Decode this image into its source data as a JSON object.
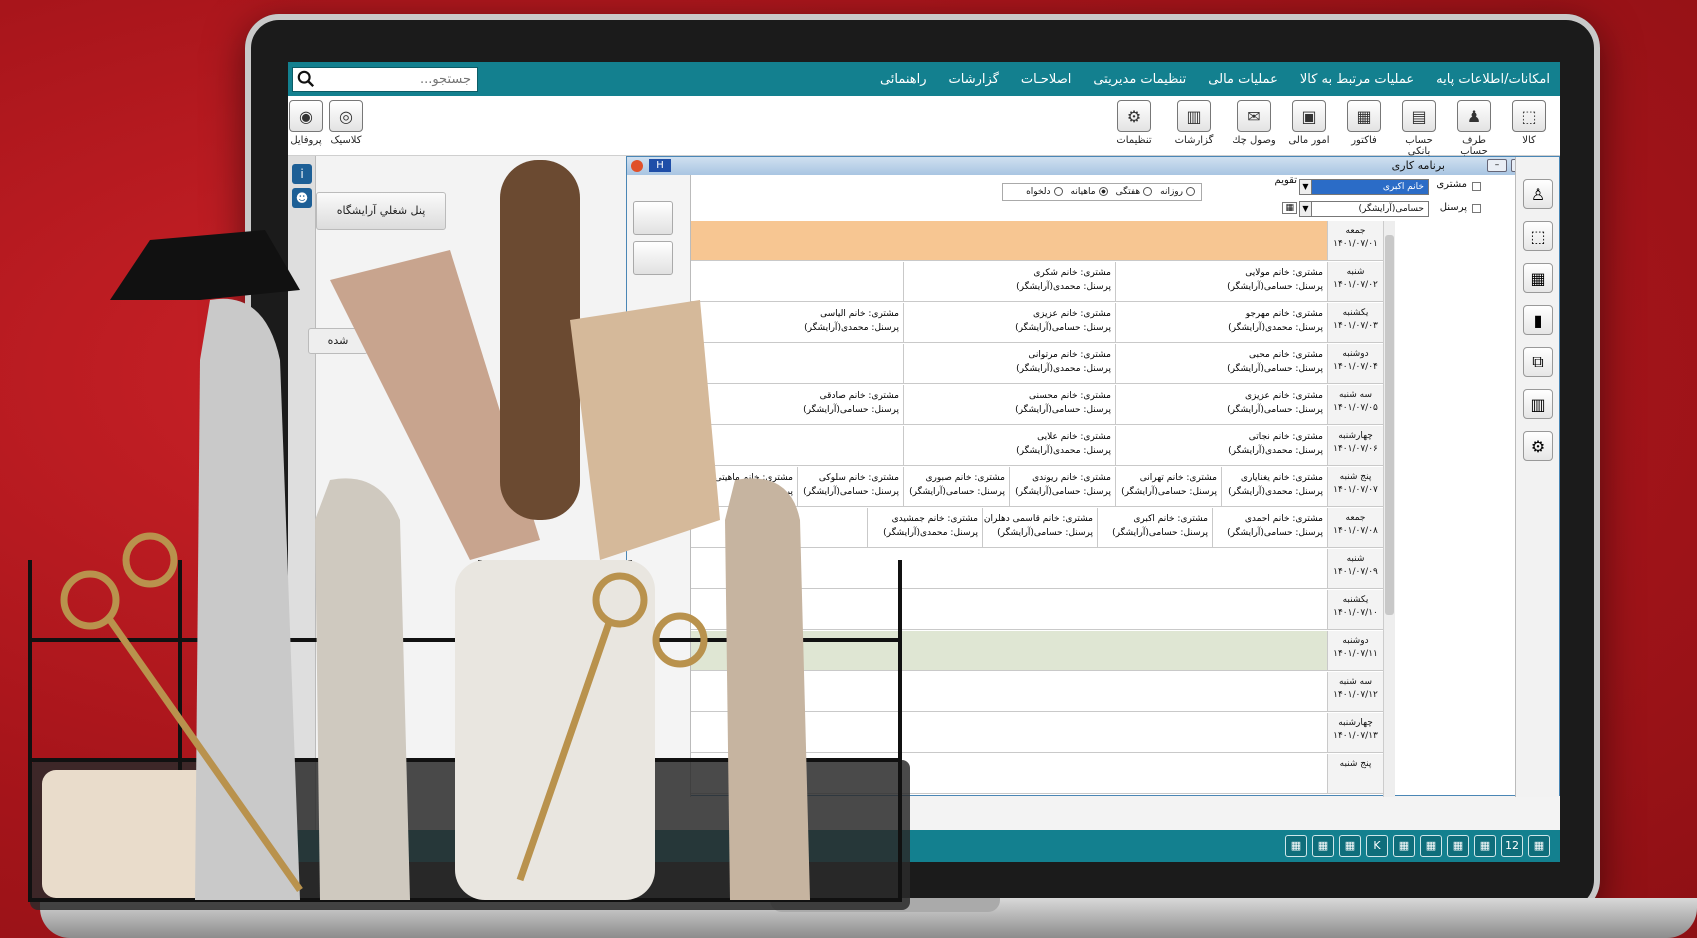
{
  "menubar": {
    "items": [
      "امکانات/اطلاعات پایه",
      "عملیات مرتبط به کالا",
      "عملیات مالی",
      "تنظیمات مدیریتی",
      "اصلاحـات",
      "گزارشات",
      "راهنمائی"
    ]
  },
  "search": {
    "placeholder": "جستجو..."
  },
  "toolbar": {
    "items": [
      "کالا",
      "طرف حساب",
      "حساب بانکی",
      "فاکتور",
      "امور مالی",
      "وصول چك",
      "گزارشات",
      "تنظیمات"
    ],
    "left_items": [
      "کلاسیک",
      "پروفایل"
    ]
  },
  "left_panel": {
    "button": "پنل شغلي آرایشگاه",
    "partial": "شده"
  },
  "window": {
    "title": "برنامه کاری",
    "badge": "H",
    "customer_label": "مشتری",
    "customer_value": "خانم اکبری",
    "staff_label": "پرسنل",
    "staff_value": "حسامی(آرایشگر)",
    "calendar_label": "تقویم",
    "radio_daily": "روزانه",
    "radio_weekly": "هفتگی",
    "radio_monthly": "ماهیانه",
    "radio_custom": "دلخواه"
  },
  "schedule": {
    "rows": [
      {
        "day": "جمعه",
        "date": "۱۴۰۱/۰۷/۰۱",
        "color": "#f7c692",
        "appts": []
      },
      {
        "day": "شنبه",
        "date": "۱۴۰۱/۰۷/۰۲",
        "color": "",
        "appts": [
          [
            "مشتری: خانم مولایی",
            "پرسنل: حسامی(آرایشگر)"
          ],
          [
            "مشتری: خانم شکری",
            "پرسنل: محمدی(آرایشگر)"
          ]
        ]
      },
      {
        "day": "یکشنبه",
        "date": "۱۴۰۱/۰۷/۰۳",
        "color": "",
        "appts": [
          [
            "مشتری: خانم مهرجو",
            "پرسنل: محمدی(آرایشگر)"
          ],
          [
            "مشتری: خانم عزیزی",
            "پرسنل: حسامی(آرایشگر)"
          ],
          [
            "مشتری: خانم الیاسی",
            "پرسنل: محمدی(آرایشگر)"
          ]
        ]
      },
      {
        "day": "دوشنبه",
        "date": "۱۴۰۱/۰۷/۰۴",
        "color": "",
        "appts": [
          [
            "مشتری: خانم محبی",
            "پرسنل: حسامی(آرایشگر)"
          ],
          [
            "مشتری: خانم مرتوانی",
            "پرسنل: محمدی(آرایشگر)"
          ]
        ]
      },
      {
        "day": "سه شنبه",
        "date": "۱۴۰۱/۰۷/۰۵",
        "color": "",
        "appts": [
          [
            "مشتری: خانم عزیزی",
            "پرسنل: حسامی(آرایشگر)"
          ],
          [
            "مشتری: خانم محسنی",
            "پرسنل: حسامی(آرایشگر)"
          ],
          [
            "مشتری: خانم صادقی",
            "پرسنل: حسامی(آرایشگر)"
          ]
        ]
      },
      {
        "day": "چهارشنبه",
        "date": "۱۴۰۱/۰۷/۰۶",
        "color": "",
        "appts": [
          [
            "مشتری: خانم نجاتی",
            "پرسنل: محمدی(آرایشگر)"
          ],
          [
            "مشتری: خانم علایی",
            "پرسنل: محمدی(آرایشگر)"
          ]
        ]
      },
      {
        "day": "پنج شنبه",
        "date": "۱۴۰۱/۰۷/۰۷",
        "color": "",
        "appts": [
          [
            "مشتری: خانم یغنایاری",
            "پرسنل: محمدی(آرایشگر)"
          ],
          [
            "مشتری: خانم تهرانی",
            "پرسنل: حسامی(آرایشگر)"
          ],
          [
            "مشتری: خانم ریوندی",
            "پرسنل: حسامی(آرایشگر)"
          ],
          [
            "مشتری: خانم صبوری",
            "پرسنل: حسامی(آرایشگر)"
          ],
          [
            "مشتری: خانم سلوکی",
            "پرسنل: حسامی(آرایشگر)"
          ],
          [
            "مشتری: خانم ماهیتی",
            "پرسنل: حسا"
          ]
        ]
      },
      {
        "day": "جمعه",
        "date": "۱۴۰۱/۰۷/۰۸",
        "color": "",
        "appts": [
          [
            "مشتری: خانم احمدی",
            "پرسنل: حسامی(آرایشگر)"
          ],
          [
            "مشتری: خانم اکبری",
            "پرسنل: حسامی(آرایشگر)"
          ],
          [
            "مشتری: خانم قاسمی دهلران",
            "پرسنل: حسامی(آرایشگر)"
          ],
          [
            "مشتری: خانم جمشیدی",
            "پرسنل: محمدی(آرایشگر)"
          ]
        ]
      },
      {
        "day": "شنبه",
        "date": "۱۴۰۱/۰۷/۰۹",
        "color": "",
        "appts": []
      },
      {
        "day": "یکشنبه",
        "date": "۱۴۰۱/۰۷/۱۰",
        "color": "",
        "appts": []
      },
      {
        "day": "دوشنبه",
        "date": "۱۴۰۱/۰۷/۱۱",
        "color": "#dfe6d3",
        "appts": []
      },
      {
        "day": "سه شنبه",
        "date": "۱۴۰۱/۰۷/۱۲",
        "color": "",
        "appts": []
      },
      {
        "day": "چهارشنبه",
        "date": "۱۴۰۱/۰۷/۱۳",
        "color": "",
        "appts": []
      },
      {
        "day": "پنج شنبه",
        "date": "",
        "color": "",
        "appts": []
      }
    ]
  },
  "statusbar": {
    "icons": [
      "calendar-icon",
      "12",
      "search-chart-icon",
      "share-icon",
      "list-icon",
      "grid-icon",
      "K",
      "phone-icon",
      "calendar-grid-icon",
      "printer-icon"
    ]
  },
  "colors": {
    "teal": "#13808f",
    "red_bg": "#b5161c"
  }
}
